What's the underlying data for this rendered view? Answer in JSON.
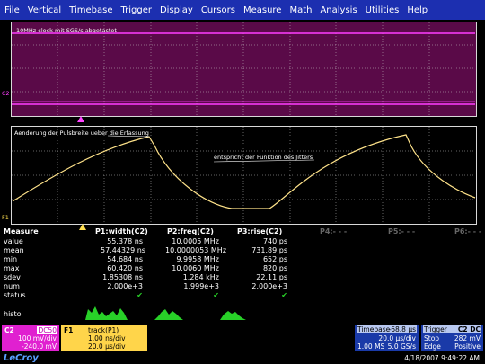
{
  "menu": [
    "File",
    "Vertical",
    "Timebase",
    "Trigger",
    "Display",
    "Cursors",
    "Measure",
    "Math",
    "Analysis",
    "Utilities",
    "Help"
  ],
  "grid1": {
    "annotation": "10MHz clock mit SGS/s abgetastet",
    "channel_marker": "C2"
  },
  "grid2": {
    "annotation1": "Aenderung der Pulsbreite ueber die Erfassung",
    "annotation2": "entspricht der Funktion des Jitters",
    "channel_marker": "F1"
  },
  "colors": {
    "menubar": "#1c2fb0",
    "c2_magenta": "#ff00ff",
    "f1_yellow": "#ffe050",
    "trace_yellow": "#ffe38a",
    "histo_green": "#28d028"
  },
  "measure": {
    "header": [
      "Measure",
      "P1:width(C2)",
      "P2:freq(C2)",
      "P3:rise(C2)",
      "P4:- - -",
      "P5:- - -",
      "P6:- - -"
    ],
    "rows": [
      {
        "label": "value",
        "p1": "55.378 ns",
        "p2": "10.0005 MHz",
        "p3": "740 ps"
      },
      {
        "label": "mean",
        "p1": "57.44329 ns",
        "p2": "10.0000053 MHz",
        "p3": "731.89 ps"
      },
      {
        "label": "min",
        "p1": "54.684 ns",
        "p2": "9.9958 MHz",
        "p3": "652 ps"
      },
      {
        "label": "max",
        "p1": "60.420 ns",
        "p2": "10.0060 MHz",
        "p3": "820 ps"
      },
      {
        "label": "sdev",
        "p1": "1.85308 ns",
        "p2": "1.284 kHz",
        "p3": "22.11 ps"
      },
      {
        "label": "num",
        "p1": "2.000e+3",
        "p2": "1.999e+3",
        "p3": "2.000e+3"
      },
      {
        "label": "status",
        "p1": "✔",
        "p2": "✔",
        "p3": "✔"
      }
    ],
    "histo_label": "histo"
  },
  "c2_box": {
    "name": "C2",
    "coupling": "DC50",
    "line1": "100 mV/div",
    "line2": "-240.0 mV"
  },
  "f1_box": {
    "name": "F1",
    "title": "track(P1)",
    "line1": "1.00 ns/div",
    "line2": "20.0 µs/div"
  },
  "timebase_box": {
    "title": "Timebase",
    "offset": "-68.8 µs",
    "row1_right": "20.0 µs/div",
    "row2_left": "1.00 MS",
    "row2_right": "5.0 GS/s"
  },
  "trigger_box": {
    "title": "Trigger",
    "tags": "C2 DC",
    "row1_left": "Stop",
    "row1_right": "282 mV",
    "row2_left": "Edge",
    "row2_right": "Positive"
  },
  "footer": {
    "logo": "LeCroy",
    "datetime": "4/18/2007 9:49:22 AM"
  }
}
